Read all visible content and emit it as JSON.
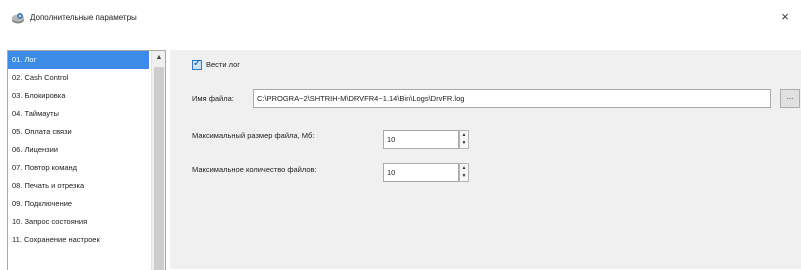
{
  "window": {
    "title": "Дополнительные параметры",
    "app_icon": "gear-disk-icon",
    "close_glyph": "×"
  },
  "sidebar": {
    "items": [
      {
        "label": "01. Лог",
        "selected": true
      },
      {
        "label": "02. Cash Control"
      },
      {
        "label": "03. Блокировка"
      },
      {
        "label": "04. Таймауты"
      },
      {
        "label": "05. Оплата связи"
      },
      {
        "label": "06. Лицензии"
      },
      {
        "label": "07. Повтор команд"
      },
      {
        "label": "08. Печать и отрезка"
      },
      {
        "label": "09. Подключение"
      },
      {
        "label": "10. Запрос состояния"
      },
      {
        "label": "11. Сохранение настроек"
      }
    ],
    "scroll_up_glyph": "▲"
  },
  "log": {
    "enable_label": "Вести лог",
    "enable_checked": true,
    "file_label": "Имя файла:",
    "file_value": "C:\\PROGRA~2\\SHTRIH-M\\DRVFR4~1.14\\Bin\\Logs\\DrvFR.log",
    "browse_label": "...",
    "max_size_label": "Максимальный размер файла, Мб:",
    "max_size_value": "10",
    "max_files_label": "Максимальное количество файлов:",
    "max_files_value": "10"
  },
  "colors": {
    "selection": "#3c8ce7",
    "panel_bg": "#f0f0f0"
  }
}
